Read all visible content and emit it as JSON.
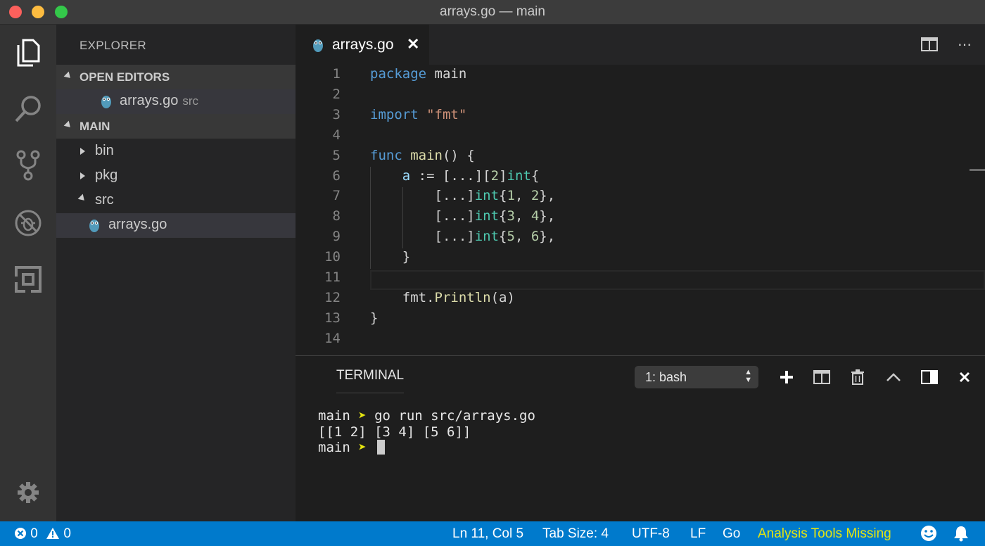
{
  "window": {
    "title": "arrays.go — main"
  },
  "activity_bar": {
    "items": [
      {
        "icon": "files-icon"
      },
      {
        "icon": "search-icon"
      },
      {
        "icon": "source-control-icon"
      },
      {
        "icon": "debug-icon"
      },
      {
        "icon": "extensions-icon"
      }
    ],
    "settings_icon": "gear-icon"
  },
  "explorer": {
    "title": "EXPLORER",
    "open_editors": {
      "label": "OPEN EDITORS",
      "items": [
        {
          "name": "arrays.go",
          "description": "src"
        }
      ]
    },
    "workspace": {
      "label": "MAIN",
      "items": [
        {
          "name": "bin"
        },
        {
          "name": "pkg"
        },
        {
          "name": "src"
        },
        {
          "name": "arrays.go"
        }
      ]
    }
  },
  "editor": {
    "tab": {
      "label": "arrays.go",
      "close_glyph": "✕"
    },
    "actions": {
      "split_icon": "split-editor-icon",
      "more_glyph": "⋯"
    },
    "line_numbers": [
      "1",
      "2",
      "3",
      "4",
      "5",
      "6",
      "7",
      "8",
      "9",
      "10",
      "11",
      "12",
      "13",
      "14"
    ],
    "lines": [
      [
        {
          "t": "package",
          "c": "kw"
        },
        {
          "t": " main",
          "c": ""
        }
      ],
      [],
      [
        {
          "t": "import",
          "c": "kw"
        },
        {
          "t": " ",
          "c": ""
        },
        {
          "t": "\"fmt\"",
          "c": "str"
        }
      ],
      [],
      [
        {
          "t": "func",
          "c": "kw"
        },
        {
          "t": " ",
          "c": ""
        },
        {
          "t": "main",
          "c": "fn"
        },
        {
          "t": "() {",
          "c": ""
        }
      ],
      [
        {
          "t": "    ",
          "c": ""
        },
        {
          "t": "a",
          "c": "var"
        },
        {
          "t": " := [...][",
          "c": ""
        },
        {
          "t": "2",
          "c": "num"
        },
        {
          "t": "]",
          "c": ""
        },
        {
          "t": "int",
          "c": "ty"
        },
        {
          "t": "{",
          "c": ""
        }
      ],
      [
        {
          "t": "        [...]",
          "c": ""
        },
        {
          "t": "int",
          "c": "ty"
        },
        {
          "t": "{",
          "c": ""
        },
        {
          "t": "1",
          "c": "num"
        },
        {
          "t": ", ",
          "c": ""
        },
        {
          "t": "2",
          "c": "num"
        },
        {
          "t": "},",
          "c": ""
        }
      ],
      [
        {
          "t": "        [...]",
          "c": ""
        },
        {
          "t": "int",
          "c": "ty"
        },
        {
          "t": "{",
          "c": ""
        },
        {
          "t": "3",
          "c": "num"
        },
        {
          "t": ", ",
          "c": ""
        },
        {
          "t": "4",
          "c": "num"
        },
        {
          "t": "},",
          "c": ""
        }
      ],
      [
        {
          "t": "        [...]",
          "c": ""
        },
        {
          "t": "int",
          "c": "ty"
        },
        {
          "t": "{",
          "c": ""
        },
        {
          "t": "5",
          "c": "num"
        },
        {
          "t": ", ",
          "c": ""
        },
        {
          "t": "6",
          "c": "num"
        },
        {
          "t": "},",
          "c": ""
        }
      ],
      [
        {
          "t": "    }",
          "c": ""
        }
      ],
      [],
      [
        {
          "t": "    fmt.",
          "c": ""
        },
        {
          "t": "Println",
          "c": "fn"
        },
        {
          "t": "(a)",
          "c": ""
        }
      ],
      [
        {
          "t": "}",
          "c": ""
        }
      ],
      []
    ],
    "cursor_line": 11
  },
  "panel": {
    "tab_label": "TERMINAL",
    "terminal_select": {
      "selected": "1: bash"
    },
    "terminal": {
      "line1_prompt": "main",
      "line1_arrow": "➤",
      "line1_command": " go run src/arrays.go",
      "line2_output": "[[1 2] [3 4] [5 6]]",
      "line3_prompt": "main",
      "line3_arrow": "➤"
    }
  },
  "status_bar": {
    "errors": "0",
    "warnings": "0",
    "position": "Ln 11, Col 5",
    "tab_size": "Tab Size: 4",
    "encoding": "UTF-8",
    "eol": "LF",
    "language": "Go",
    "analysis": "Analysis Tools Missing"
  },
  "colors": {
    "accent": "#007acc",
    "keyword": "#569cd6",
    "string": "#ce9178",
    "function": "#dcdcaa",
    "type": "#4ec9b0",
    "number": "#b5cea8",
    "variable": "#9cdcfe",
    "warning_text": "#e5e510"
  }
}
